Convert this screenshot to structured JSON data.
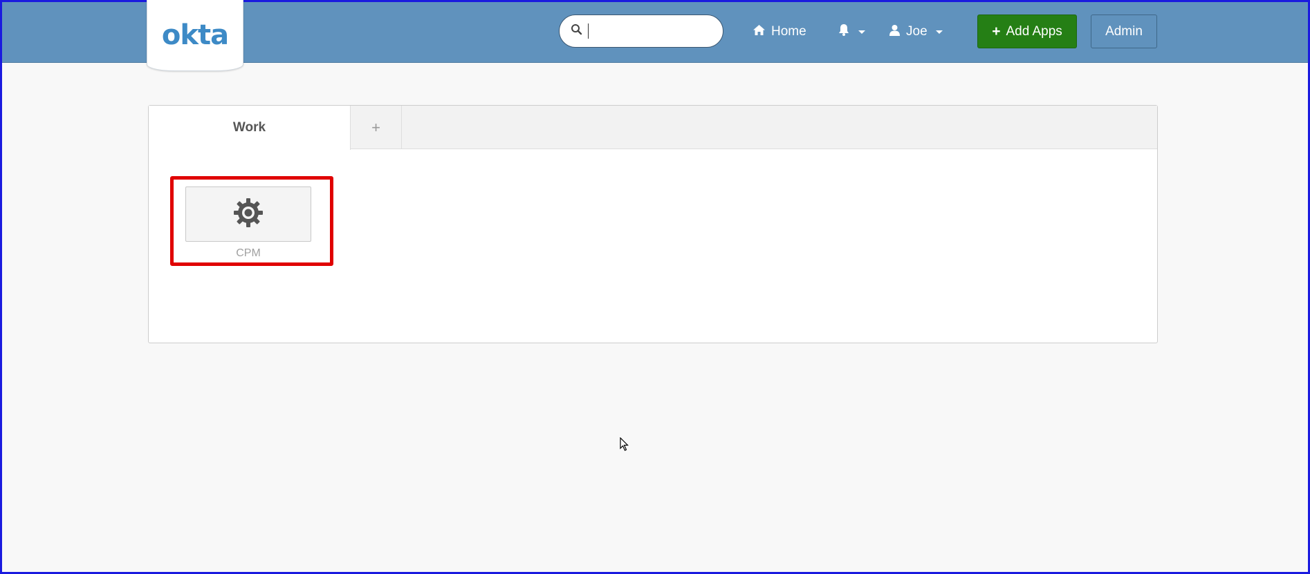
{
  "header": {
    "logo_text": "okta",
    "search": {
      "value": "",
      "placeholder": ""
    },
    "nav": {
      "home_label": "Home",
      "user_label": "Joe"
    },
    "add_apps_label": "Add Apps",
    "add_apps_plus": "+",
    "admin_label": "Admin"
  },
  "tabs": [
    {
      "label": "Work",
      "active": true
    },
    {
      "label": "+",
      "active": false
    }
  ],
  "apps": [
    {
      "label": "CPM",
      "icon": "gear-icon",
      "highlighted": true
    }
  ],
  "colors": {
    "header_bg": "#6092bd",
    "add_apps_bg": "#257f15",
    "highlight": "#e00000",
    "logo": "#3d8ac6"
  }
}
